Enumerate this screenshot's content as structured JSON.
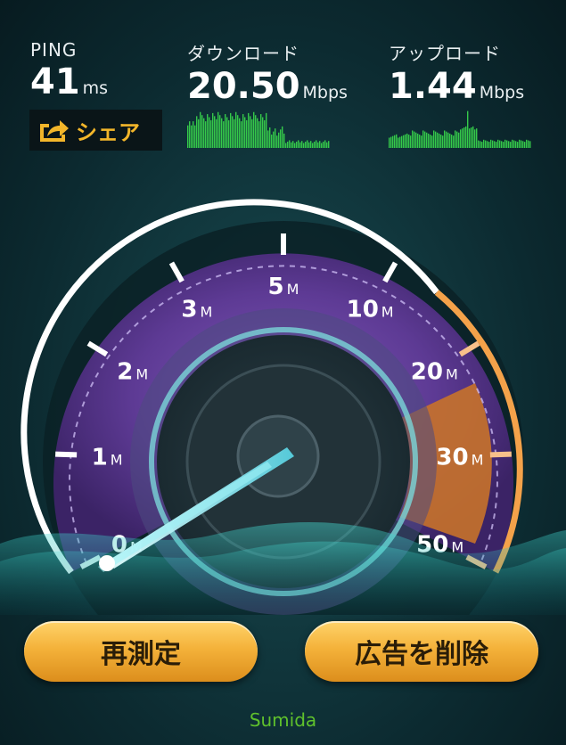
{
  "stats": {
    "ping": {
      "label": "PING",
      "value": "41",
      "unit": "ms"
    },
    "download": {
      "label": "ダウンロード",
      "value": "20.50",
      "unit": "Mbps"
    },
    "upload": {
      "label": "アップロード",
      "value": "1.44",
      "unit": "Mbps"
    }
  },
  "share": {
    "label": "シェア",
    "icon": "share-icon"
  },
  "gauge": {
    "ticks": [
      {
        "num": "0",
        "unit": "M"
      },
      {
        "num": "1",
        "unit": "M"
      },
      {
        "num": "2",
        "unit": "M"
      },
      {
        "num": "3",
        "unit": "M"
      },
      {
        "num": "5",
        "unit": "M"
      },
      {
        "num": "10",
        "unit": "M"
      },
      {
        "num": "20",
        "unit": "M"
      },
      {
        "num": "30",
        "unit": "M"
      },
      {
        "num": "50",
        "unit": "M"
      }
    ],
    "needle_value": "0"
  },
  "buttons": {
    "retest": "再測定",
    "remove_ads": "広告を削除"
  },
  "server": "Sumida",
  "colors": {
    "accent_orange": "#f3b62a",
    "graph_green": "#35c94a",
    "server_green": "#5fc12c",
    "purple": "#6a3fa0"
  }
}
